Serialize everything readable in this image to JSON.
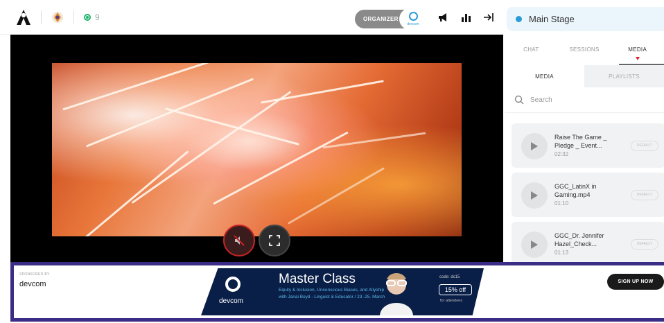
{
  "header": {
    "viewer_count": "9",
    "role_label": "ORGANIZER",
    "role_brand": "devcom"
  },
  "stage": {
    "name": "Main Stage"
  },
  "panel": {
    "tabs": [
      "CHAT",
      "SESSIONS",
      "MEDIA"
    ],
    "active_tab": "MEDIA",
    "subtabs": [
      "MEDIA",
      "PLAYLISTS"
    ],
    "search_placeholder": "Search",
    "items": [
      {
        "title": "Raise The Game _ Pledge _ Event...",
        "duration": "02:32",
        "badge": "DEFAULT"
      },
      {
        "title": "GGC_LatinX in Gaming.mp4",
        "duration": "01:10",
        "badge": "DEFAULT"
      },
      {
        "title": "GGC_Dr. Jennifer Hazel_Check...",
        "duration": "01:13",
        "badge": "DEFAULT"
      }
    ]
  },
  "sponsor": {
    "label": "SPONSORED BY",
    "name": "devcom",
    "banner": {
      "brand": "devcom",
      "title": "Master Class",
      "subtitle": "Equity & Inclusion, Unconscious Biases, and Allyship with Janai Boyd - Linguist & Educator / 23.-25. March",
      "code": "code: dc15",
      "discount": "15% off",
      "note": "for attendees"
    },
    "cta": "SIGN UP NOW"
  },
  "colors": {
    "accent_blue": "#2a9bd8",
    "live_green": "#1cb36b",
    "mute_red": "#c72323",
    "sponsor_border": "#3b2d86"
  }
}
